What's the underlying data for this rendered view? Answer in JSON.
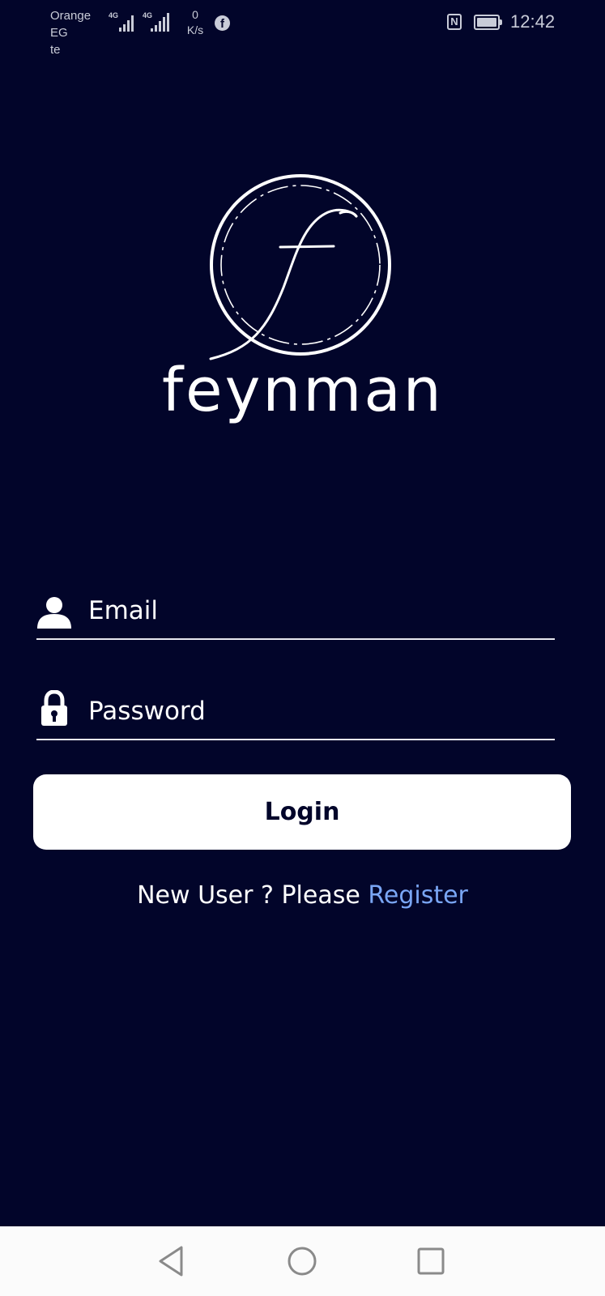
{
  "status_bar": {
    "carrier_line1": "Orange EG",
    "carrier_line2": "te",
    "signal1_tag": "4G",
    "signal2_tag": "4G",
    "speed_value": "0",
    "speed_unit": "K/s",
    "fb_glyph": "f",
    "nfc_glyph": "N",
    "time": "12:42",
    "icons": [
      "signal-icon",
      "signal-icon",
      "facebook-icon",
      "nfc-icon",
      "battery-icon"
    ]
  },
  "logo": {
    "wordmark": "feynman",
    "icon": "feynman-logo-icon"
  },
  "form": {
    "email": {
      "placeholder": "Email",
      "value": "",
      "icon": "user-icon"
    },
    "password": {
      "placeholder": "Password",
      "value": "",
      "icon": "lock-icon"
    },
    "login_label": "Login",
    "register_prompt": "New User ? Please",
    "register_link": "Register"
  },
  "nav_bar": {
    "icons": [
      "back-icon",
      "home-icon",
      "recents-icon"
    ]
  },
  "colors": {
    "background": "#02052a",
    "link": "#7aa6f5",
    "button": "#ffffff",
    "button_text": "#02052a"
  }
}
